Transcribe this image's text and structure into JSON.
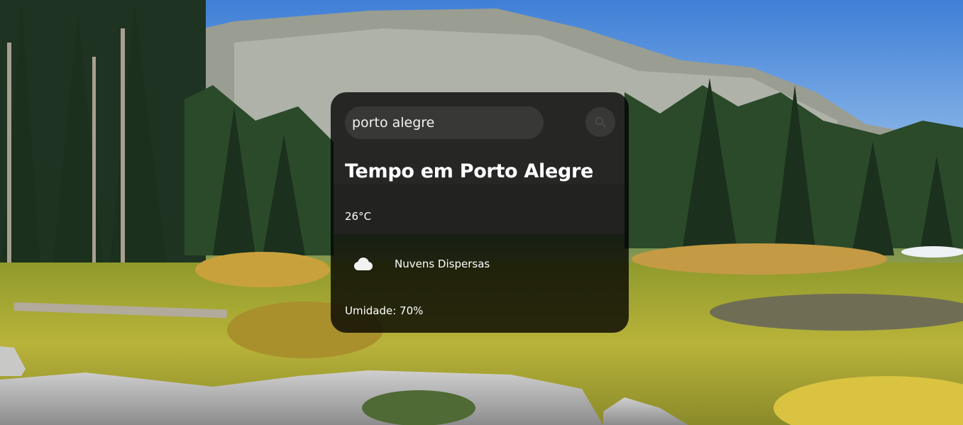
{
  "search": {
    "value": "porto alegre",
    "placeholder": "",
    "button_icon": "search-icon"
  },
  "weather": {
    "title": "Tempo em Porto Alegre",
    "temperature": "26°C",
    "condition_icon": "cloud-icon",
    "condition": "Nuvens Dispersas",
    "humidity": "Umidade: 70%"
  },
  "colors": {
    "card_background": "rgba(0,0,0,0.78)",
    "text": "#ffffff"
  }
}
